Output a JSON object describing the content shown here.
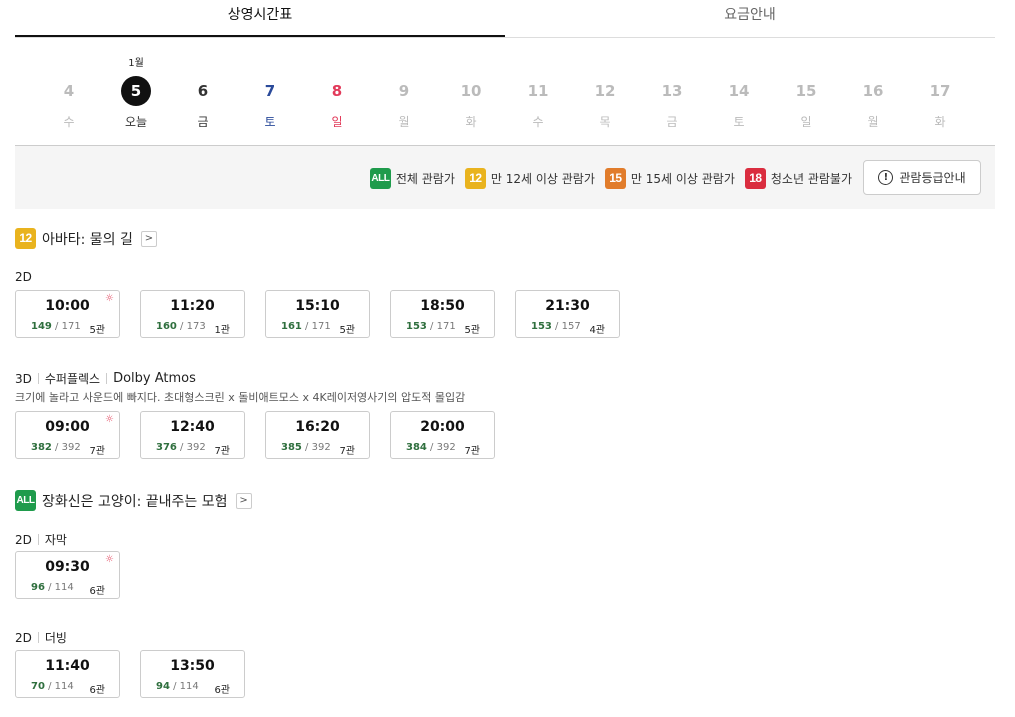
{
  "tabs": [
    {
      "label": "상영시간표",
      "active": true
    },
    {
      "label": "요금안내",
      "active": false
    }
  ],
  "dates": {
    "month_label": "1월",
    "days": [
      {
        "num": "4",
        "weekday": "수",
        "state": "disabled"
      },
      {
        "num": "5",
        "weekday": "오늘",
        "state": "selected"
      },
      {
        "num": "6",
        "weekday": "금",
        "state": "normal"
      },
      {
        "num": "7",
        "weekday": "토",
        "state": "sat"
      },
      {
        "num": "8",
        "weekday": "일",
        "state": "sun"
      },
      {
        "num": "9",
        "weekday": "월",
        "state": "disabled"
      },
      {
        "num": "10",
        "weekday": "화",
        "state": "disabled"
      },
      {
        "num": "11",
        "weekday": "수",
        "state": "disabled"
      },
      {
        "num": "12",
        "weekday": "목",
        "state": "disabled"
      },
      {
        "num": "13",
        "weekday": "금",
        "state": "disabled"
      },
      {
        "num": "14",
        "weekday": "토",
        "state": "disabled"
      },
      {
        "num": "15",
        "weekday": "일",
        "state": "disabled"
      },
      {
        "num": "16",
        "weekday": "월",
        "state": "disabled"
      },
      {
        "num": "17",
        "weekday": "화",
        "state": "disabled"
      }
    ]
  },
  "legend": {
    "items": [
      {
        "badge": "ALL",
        "label": "전체 관람가",
        "color": "#1f9b4c"
      },
      {
        "badge": "12",
        "label": "만 12세 이상 관람가",
        "color": "#e9b31e"
      },
      {
        "badge": "15",
        "label": "만 15세 이상 관람가",
        "color": "#e17c2b"
      },
      {
        "badge": "18",
        "label": "청소년 관람불가",
        "color": "#da2d3f"
      }
    ],
    "guide_button": "관람등급안내",
    "guide_icon": "!"
  },
  "movies": [
    {
      "rating": "12",
      "title": "아바타: 물의 길",
      "arrow": ">",
      "formats": [
        {
          "format": [
            "2D"
          ],
          "desc": "",
          "times": [
            {
              "time": "10:00",
              "avail": "149",
              "total": "171",
              "hall": "5관",
              "morning": true
            },
            {
              "time": "11:20",
              "avail": "160",
              "total": "173",
              "hall": "1관",
              "morning": false
            },
            {
              "time": "15:10",
              "avail": "161",
              "total": "171",
              "hall": "5관",
              "morning": false
            },
            {
              "time": "18:50",
              "avail": "153",
              "total": "171",
              "hall": "5관",
              "morning": false
            },
            {
              "time": "21:30",
              "avail": "153",
              "total": "157",
              "hall": "4관",
              "morning": false
            }
          ]
        },
        {
          "format": [
            "3D",
            "수퍼플렉스",
            "Dolby Atmos"
          ],
          "desc": "크기에 놀라고 사운드에 빠지다. 초대형스크린 x 돌비애트모스 x 4K레이저영사기의 압도적 몰입감",
          "times": [
            {
              "time": "09:00",
              "avail": "382",
              "total": "392",
              "hall": "7관",
              "morning": true
            },
            {
              "time": "12:40",
              "avail": "376",
              "total": "392",
              "hall": "7관",
              "morning": false
            },
            {
              "time": "16:20",
              "avail": "385",
              "total": "392",
              "hall": "7관",
              "morning": false
            },
            {
              "time": "20:00",
              "avail": "384",
              "total": "392",
              "hall": "7관",
              "morning": false
            }
          ]
        }
      ]
    },
    {
      "rating": "ALL",
      "title": "장화신은 고양이: 끝내주는 모험",
      "arrow": ">",
      "formats": [
        {
          "format": [
            "2D",
            "자막"
          ],
          "desc": "",
          "times": [
            {
              "time": "09:30",
              "avail": "96",
              "total": "114",
              "hall": "6관",
              "morning": true
            }
          ]
        },
        {
          "format": [
            "2D",
            "더빙"
          ],
          "desc": "",
          "times": [
            {
              "time": "11:40",
              "avail": "70",
              "total": "114",
              "hall": "6관",
              "morning": false
            },
            {
              "time": "13:50",
              "avail": "94",
              "total": "114",
              "hall": "6관",
              "morning": false
            }
          ]
        }
      ]
    }
  ],
  "icons": {
    "morning": "sun-icon",
    "arrow": "chevron-right-icon",
    "info": "info-circle-icon"
  }
}
